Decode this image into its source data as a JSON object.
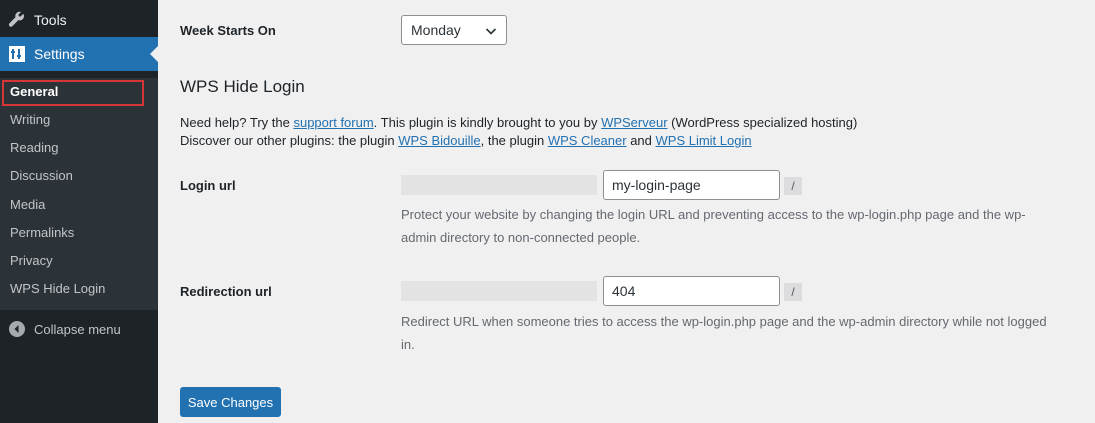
{
  "sidebar": {
    "tools_label": "Tools",
    "settings_label": "Settings",
    "submenu": {
      "general": "General",
      "writing": "Writing",
      "reading": "Reading",
      "discussion": "Discussion",
      "media": "Media",
      "permalinks": "Permalinks",
      "privacy": "Privacy",
      "wps_hide_login": "WPS Hide Login"
    },
    "collapse_label": "Collapse menu"
  },
  "settings": {
    "week_starts_label": "Week Starts On",
    "week_starts_value": "Monday"
  },
  "plugin": {
    "title": "WPS Hide Login",
    "help_1": "Need help? Try the ",
    "support_link": "support forum",
    "help_2": ". This plugin is kindly brought to you by ",
    "wpserveur_link": "WPServeur",
    "help_3": " (WordPress specialized hosting)",
    "discover_1": "Discover our other plugins: the plugin ",
    "bidouille_link": "WPS Bidouille",
    "discover_2": ", the plugin ",
    "cleaner_link": "WPS Cleaner",
    "discover_3": " and ",
    "limit_link": "WPS Limit Login",
    "login_url_label": "Login url",
    "login_url_value": "my-login-page",
    "login_url_suffix": "/",
    "login_url_desc": "Protect your website by changing the login URL and preventing access to the wp-login.php page and the wp-admin directory to non-connected people.",
    "redirect_url_label": "Redirection url",
    "redirect_url_value": "404",
    "redirect_url_suffix": "/",
    "redirect_url_desc": "Redirect URL when someone tries to access the wp-login.php page and the wp-admin directory while not logged in."
  },
  "save_label": "Save Changes",
  "colors": {
    "sidebar_bg": "#1d2327",
    "accent": "#2271b1",
    "highlight_border": "#d63638"
  }
}
